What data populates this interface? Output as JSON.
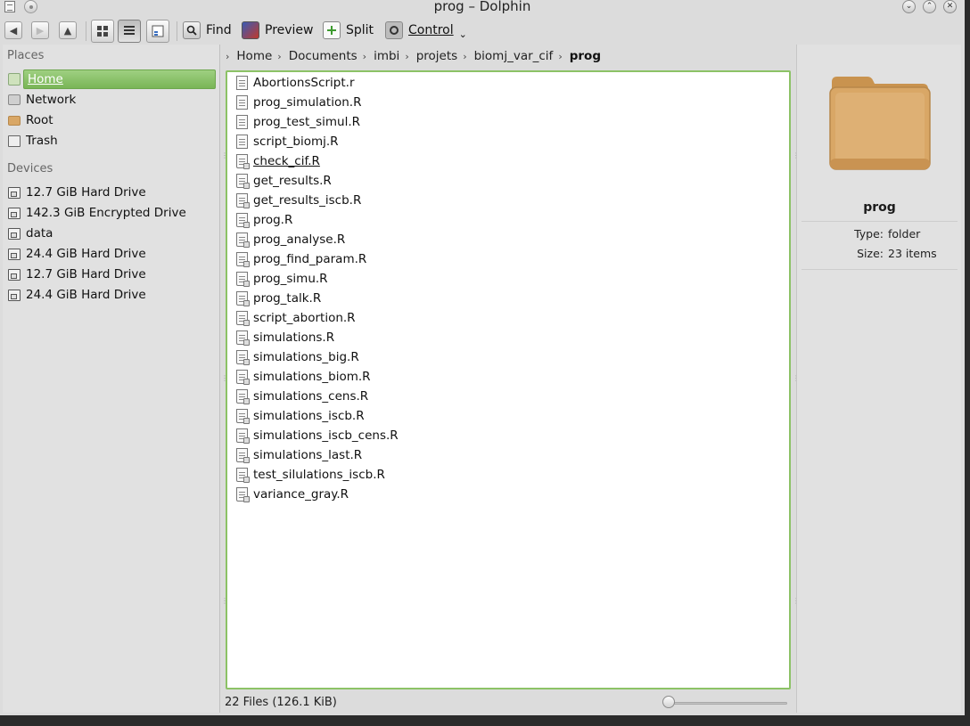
{
  "window": {
    "title": "prog – Dolphin"
  },
  "toolbar": {
    "find_label": "Find",
    "preview_label": "Preview",
    "split_label": "Split",
    "control_label": "Control"
  },
  "places": {
    "heading": "Places",
    "items": [
      {
        "label": "Home",
        "icon": "home-icon",
        "selected": true
      },
      {
        "label": "Network",
        "icon": "network-icon"
      },
      {
        "label": "Root",
        "icon": "folder-icon"
      },
      {
        "label": "Trash",
        "icon": "trash-icon"
      }
    ],
    "devices_heading": "Devices",
    "devices": [
      {
        "label": "12.7 GiB Hard Drive"
      },
      {
        "label": "142.3 GiB Encrypted Drive"
      },
      {
        "label": "data"
      },
      {
        "label": "24.4 GiB Hard Drive"
      },
      {
        "label": "12.7 GiB Hard Drive"
      },
      {
        "label": "24.4 GiB Hard Drive"
      }
    ]
  },
  "breadcrumb": [
    "Home",
    "Documents",
    "imbi",
    "projets",
    "biomj_var_cif",
    "prog"
  ],
  "files": [
    {
      "name": "AbortionsScript.r",
      "kind": "text"
    },
    {
      "name": "prog_simulation.R",
      "kind": "text"
    },
    {
      "name": "prog_test_simul.R",
      "kind": "text"
    },
    {
      "name": "script_biomj.R",
      "kind": "text"
    },
    {
      "name": "check_cif.R",
      "kind": "script",
      "hover": true
    },
    {
      "name": "get_results.R",
      "kind": "script"
    },
    {
      "name": "get_results_iscb.R",
      "kind": "script"
    },
    {
      "name": "prog.R",
      "kind": "script"
    },
    {
      "name": "prog_analyse.R",
      "kind": "script"
    },
    {
      "name": "prog_find_param.R",
      "kind": "script"
    },
    {
      "name": "prog_simu.R",
      "kind": "script"
    },
    {
      "name": "prog_talk.R",
      "kind": "script"
    },
    {
      "name": "script_abortion.R",
      "kind": "script"
    },
    {
      "name": "simulations.R",
      "kind": "script"
    },
    {
      "name": "simulations_big.R",
      "kind": "script"
    },
    {
      "name": "simulations_biom.R",
      "kind": "script"
    },
    {
      "name": "simulations_cens.R",
      "kind": "script"
    },
    {
      "name": "simulations_iscb.R",
      "kind": "script"
    },
    {
      "name": "simulations_iscb_cens.R",
      "kind": "script"
    },
    {
      "name": "simulations_last.R",
      "kind": "script"
    },
    {
      "name": "test_silulations_iscb.R",
      "kind": "script"
    },
    {
      "name": "variance_gray.R",
      "kind": "script"
    }
  ],
  "info": {
    "name": "prog",
    "type_key": "Type:",
    "type_value": "folder",
    "size_key": "Size:",
    "size_value": "23 items"
  },
  "status": {
    "text": "22 Files (126.1 KiB)"
  },
  "colors": {
    "selection": "#8cc266",
    "folder": "#d9a766"
  }
}
